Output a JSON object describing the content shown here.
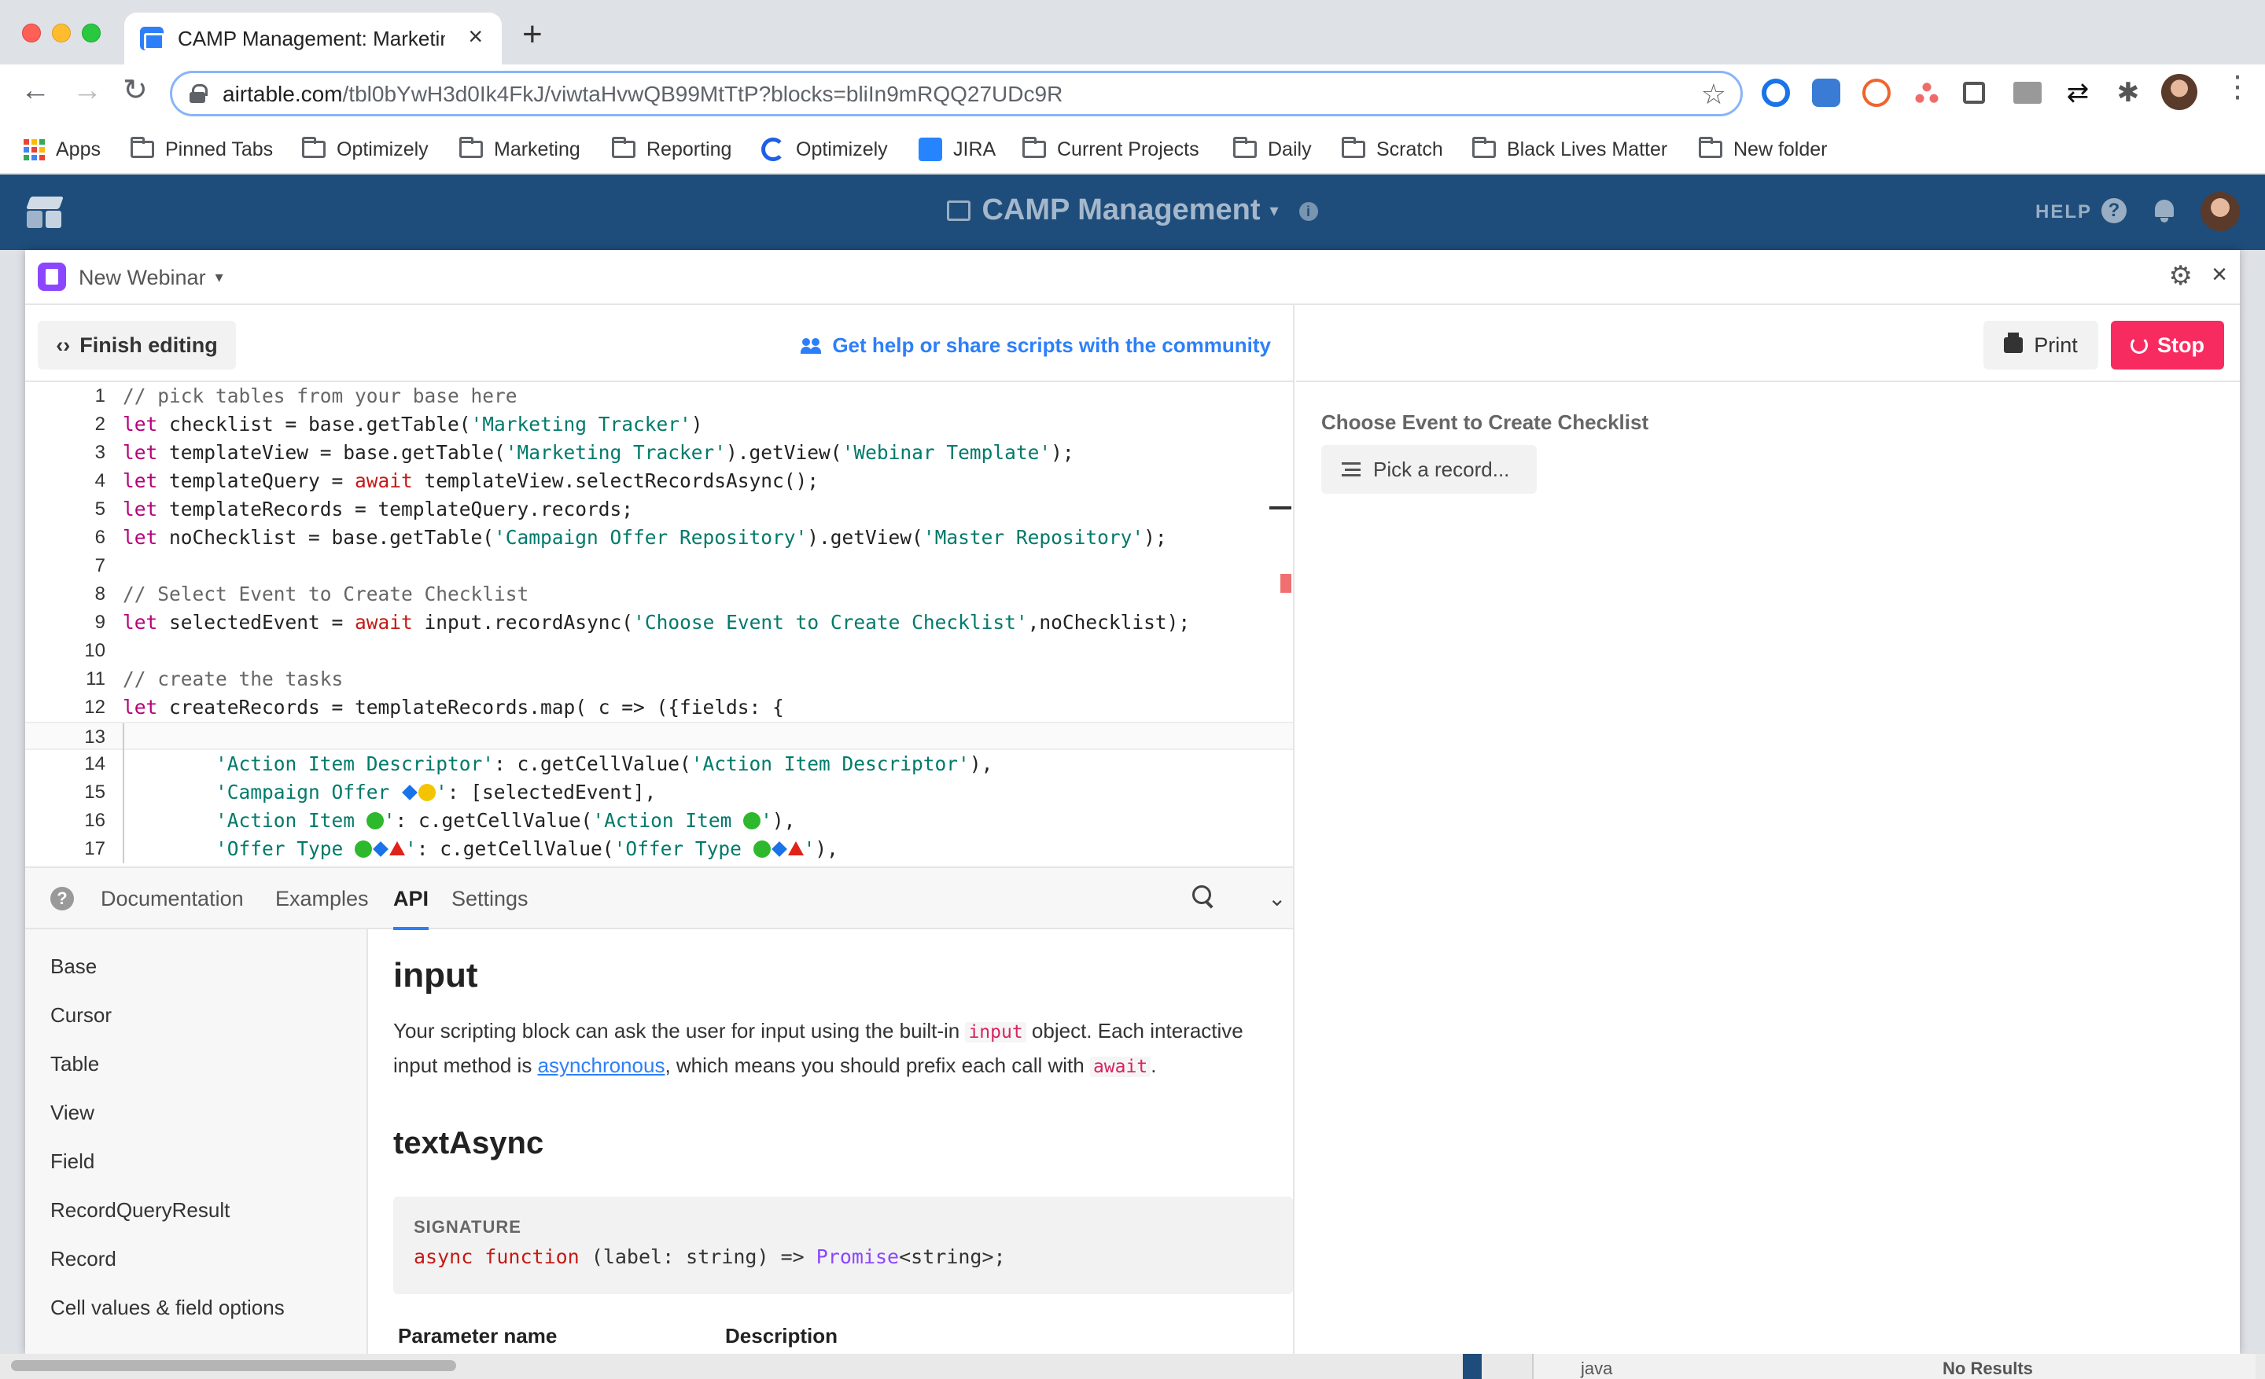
{
  "browser": {
    "tab_title": "CAMP Management: Marketing",
    "new_tab_label": "+",
    "close_tab_label": "×",
    "url_domain": "airtable.com",
    "url_path": "/tbl0bYwH3d0Ik4FkJ/viwtaHvwQB99MtTtP?blocks=bliIn9mRQQ27UDc9R",
    "bookmarks": [
      {
        "label": "Apps",
        "icon": "apps-grid-icon"
      },
      {
        "label": "Pinned Tabs",
        "icon": "folder-icon"
      },
      {
        "label": "Optimizely",
        "icon": "folder-icon"
      },
      {
        "label": "Marketing",
        "icon": "folder-icon"
      },
      {
        "label": "Reporting",
        "icon": "folder-icon"
      },
      {
        "label": "Optimizely",
        "icon": "optimizely-icon"
      },
      {
        "label": "JIRA",
        "icon": "jira-icon"
      },
      {
        "label": "Current Projects",
        "icon": "folder-icon"
      },
      {
        "label": "Daily",
        "icon": "folder-icon"
      },
      {
        "label": "Scratch",
        "icon": "folder-icon"
      },
      {
        "label": "Black Lives Matter",
        "icon": "folder-icon"
      },
      {
        "label": "New folder",
        "icon": "folder-icon"
      }
    ]
  },
  "airtable": {
    "base_title": "CAMP Management",
    "help_label": "HELP",
    "colors": {
      "header": "#1e4d7b",
      "accent": "#2d7ff9",
      "stop": "#f82b60"
    }
  },
  "block": {
    "name": "New Webinar",
    "finish_editing_label": "Finish editing",
    "community_link": "Get help or share scripts with the community",
    "print_label": "Print",
    "stop_label": "Stop"
  },
  "code_lines": [
    {
      "n": "1",
      "text": "// pick tables from your base here"
    },
    {
      "n": "2",
      "text": "let checklist = base.getTable('Marketing Tracker')"
    },
    {
      "n": "3",
      "text": "let templateView = base.getTable('Marketing Tracker').getView('Webinar Template');"
    },
    {
      "n": "4",
      "text": "let templateQuery = await templateView.selectRecordsAsync();"
    },
    {
      "n": "5",
      "text": "let templateRecords = templateQuery.records;"
    },
    {
      "n": "6",
      "text": "let noChecklist = base.getTable('Campaign Offer Repository').getView('Master Repository');"
    },
    {
      "n": "7",
      "text": ""
    },
    {
      "n": "8",
      "text": "// Select Event to Create Checklist"
    },
    {
      "n": "9",
      "text": "let selectedEvent = await input.recordAsync('Choose Event to Create Checklist',noChecklist);"
    },
    {
      "n": "10",
      "text": ""
    },
    {
      "n": "11",
      "text": "// create the tasks"
    },
    {
      "n": "12",
      "text": "let createRecords = templateRecords.map( c => ({fields: {"
    },
    {
      "n": "13",
      "text": ""
    },
    {
      "n": "14",
      "text": "        'Action Item Descriptor': c.getCellValue('Action Item Descriptor'),"
    },
    {
      "n": "15",
      "text": "        'Campaign Offer ◆●': [selectedEvent],"
    },
    {
      "n": "16",
      "text": "        'Action Item ●': c.getCellValue('Action Item ●'),"
    },
    {
      "n": "17",
      "text": "        'Offer Type ●◆▲': c.getCellValue('Offer Type ●◆▲'),"
    }
  ],
  "docs": {
    "tabs": [
      "Documentation",
      "Examples",
      "API",
      "Settings"
    ],
    "active_tab": "API",
    "nav": [
      "Base",
      "Cursor",
      "Table",
      "View",
      "Field",
      "RecordQueryResult",
      "Record",
      "Cell values & field options"
    ],
    "heading": "input",
    "para_1": "Your scripting block can ask the user for input using the built-in ",
    "para_code_1": "input",
    "para_2": " object. Each interactive input method is ",
    "para_link": "asynchronous",
    "para_3": ", which means you should prefix each call with ",
    "para_code_2": "await",
    "para_4": ".",
    "subheading": "textAsync",
    "signature_label": "SIGNATURE",
    "sig_kw": "async function",
    "sig_mid": " (label: string) => ",
    "sig_type": "Promise",
    "sig_end": "<string>;",
    "param_name_header": "Parameter name",
    "description_header": "Description"
  },
  "output": {
    "label": "Choose Event to Create Checklist",
    "pick_label": "Pick a record..."
  },
  "background": {
    "find_query": "java",
    "find_result": "No Results"
  }
}
